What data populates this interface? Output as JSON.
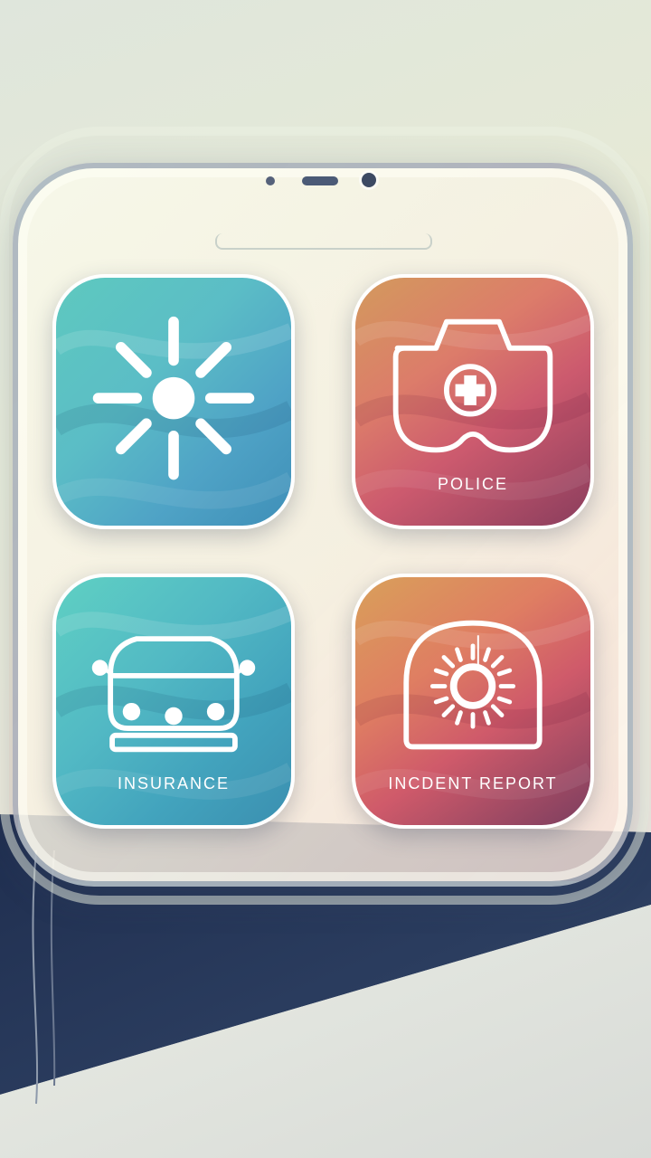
{
  "tiles": [
    {
      "id": "weather",
      "label": "",
      "icon": "sun-icon",
      "color_top": "#5ec9bf",
      "color_bottom": "#3f8fb8"
    },
    {
      "id": "police",
      "label": "POLICE",
      "icon": "police-shield-icon",
      "color_top": "#d39a5d",
      "color_bottom": "#8a3d5d"
    },
    {
      "id": "insurance",
      "label": "INSURANCE",
      "icon": "car-icon",
      "color_top": "#5fd0c3",
      "color_bottom": "#3b8fb0"
    },
    {
      "id": "incident",
      "label": "INCDENT REPORT",
      "icon": "alarm-light-icon",
      "color_top": "#d9a05a",
      "color_bottom": "#7c3e5f"
    }
  ],
  "colors": {
    "icon_stroke": "#ffffff",
    "tile_border": "#ffffff",
    "device_frame": "#788ca5"
  }
}
